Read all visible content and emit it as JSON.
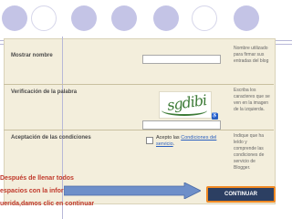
{
  "form": {
    "rows": [
      {
        "label": "Mostrar nombre",
        "help": "Nombre utilizado para firmar sus entradas del blog"
      },
      {
        "label": "Verificación de la palabra",
        "help": "Escriba los caracteres que se ven en la imagen de la izquierda."
      },
      {
        "label": "Aceptación de las condiciones",
        "help": "Indique que ha leído y comprende las condiciones de servicio de Blogger."
      }
    ],
    "captcha_text": "sgdibi",
    "accept_prefix": "Acepto las ",
    "accept_link": "Condiciones del servicio",
    "accept_suffix": ".",
    "continue_label": "CONTINUAR"
  },
  "overlay": {
    "line1": "Después de llenar todos",
    "line2": "espacios con la información",
    "line3": "uerida,damos clic en continuar"
  },
  "colors": {
    "overlay_text": "#c0392b",
    "button_bg": "#2c3f62",
    "button_border": "#f08a24",
    "link": "#2a5fbf"
  }
}
